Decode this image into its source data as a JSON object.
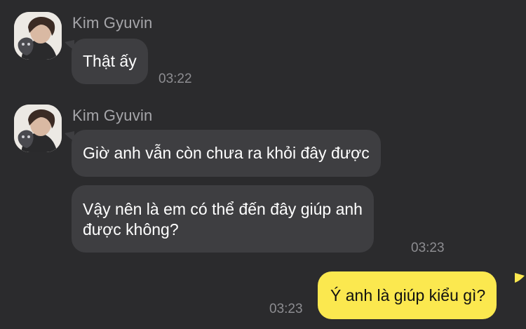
{
  "chat": {
    "messages": [
      {
        "sender": "Kim Gyuvin",
        "text": "Thật ấy",
        "time": "03:22"
      },
      {
        "sender": "Kim Gyuvin",
        "text": "Giờ anh vẫn còn chưa ra khỏi đây được",
        "time": ""
      },
      {
        "sender": "",
        "text_line1": "Vậy nên là em có thể đến đây giúp anh",
        "text_line2": "được không?",
        "time": "03:23"
      },
      {
        "sender": "me",
        "text": "Ý anh là giúp kiểu gì?",
        "time": "03:23"
      }
    ]
  },
  "icons": {
    "avatar": "profile-photo-avatar"
  },
  "colors": {
    "background": "#2b2b2d",
    "incoming_bubble": "#3e3e41",
    "outgoing_bubble": "#fbe84f",
    "sender_name": "#a6a6aa",
    "timestamp": "#8d8d91"
  }
}
